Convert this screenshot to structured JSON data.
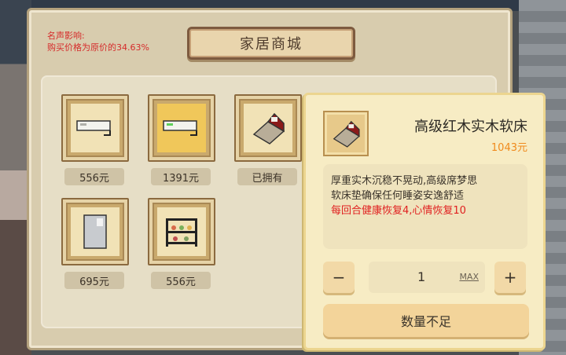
{
  "shop": {
    "title": "家居商城",
    "fame_heading": "名声影响:",
    "fame_effect": "购买价格为原价的34.63%"
  },
  "items": [
    {
      "name": "air-conditioner-white",
      "price": "556元",
      "icon": "air-conditioner-icon"
    },
    {
      "name": "air-conditioner-green",
      "price": "1391元",
      "icon": "air-conditioner-icon"
    },
    {
      "name": "wooden-bed",
      "price": "已拥有",
      "icon": "bed-icon"
    },
    {
      "name": "refrigerator",
      "price": "695元",
      "icon": "fridge-icon"
    },
    {
      "name": "shelf-rack",
      "price": "556元",
      "icon": "shelf-icon"
    }
  ],
  "detail": {
    "name": "高级红木实木软床",
    "price": "1043元",
    "desc_line1": "厚重实木沉稳不晃动,高级席梦思",
    "desc_line2": "软床垫确保任何睡姿安逸舒适",
    "effect": "每回合健康恢复4,心情恢复10",
    "qty": "1",
    "max_label": "MAX",
    "minus": "−",
    "plus": "+",
    "confirm": "数量不足"
  }
}
